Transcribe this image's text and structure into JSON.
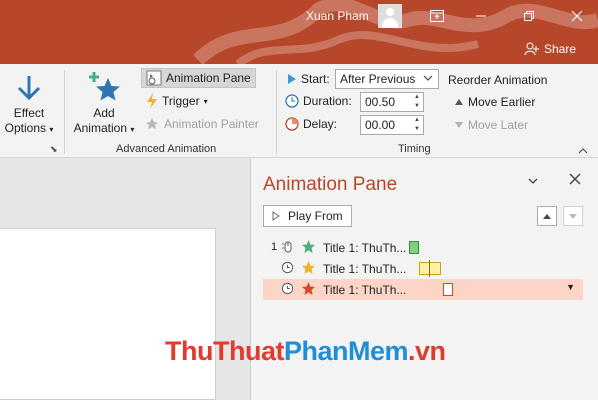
{
  "titlebar": {
    "user_name": "Xuan Pham",
    "share_label": "Share"
  },
  "ribbon": {
    "effect_options": {
      "line1": "Effect",
      "line2": "Options"
    },
    "add_animation": {
      "line1": "Add",
      "line2": "Animation"
    },
    "animation_pane_label": "Animation Pane",
    "trigger_label": "Trigger",
    "animation_painter_label": "Animation Painter",
    "advanced_group_label": "Advanced Animation",
    "start_label": "Start:",
    "start_value": "After Previous",
    "duration_label": "Duration:",
    "duration_value": "00.50",
    "delay_label": "Delay:",
    "delay_value": "00.00",
    "timing_group_label": "Timing",
    "reorder_title": "Reorder Animation",
    "move_earlier_label": "Move Earlier",
    "move_later_label": "Move Later"
  },
  "pane": {
    "title": "Animation Pane",
    "play_from_label": "Play From",
    "rows": [
      {
        "number": "1",
        "label": "Title 1: ThuTh...",
        "star_color": "#4caf7d",
        "bar_color": "#7bd37b",
        "bar_border": "#3a8e3a"
      },
      {
        "number": "",
        "label": "Title 1: ThuTh...",
        "star_color": "#f0b429",
        "bar_color": "#fff2a8",
        "bar_border": "#c8a020"
      },
      {
        "number": "",
        "label": "Title 1: ThuTh...",
        "star_color": "#d9452b",
        "bar_color": "#ffffff",
        "bar_border": "#d9452b"
      }
    ]
  },
  "watermark": {
    "part1": "ThuThuat",
    "part2": "PhanMem",
    "part3": ".vn",
    "color1": "#e23b2e",
    "color2": "#1f8ed8",
    "color3": "#e23b2e"
  }
}
